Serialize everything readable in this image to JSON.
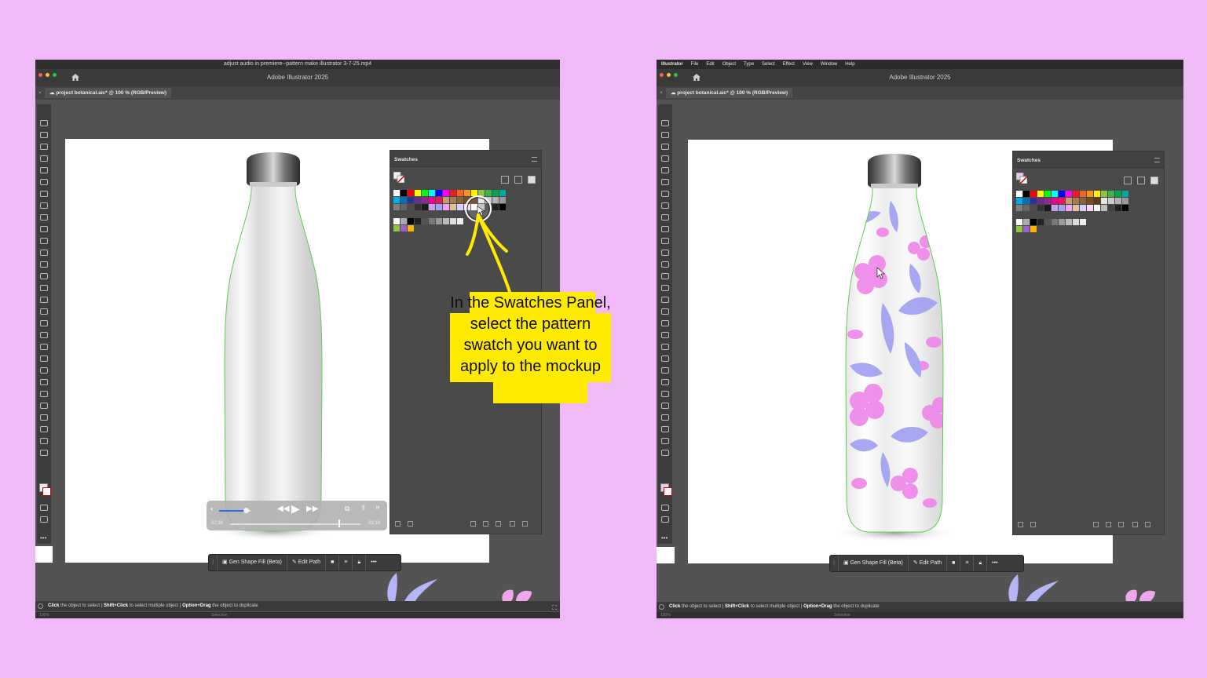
{
  "colors": {
    "background": "#f0b9f8",
    "callout_fill": "#ffeb00",
    "selection_outline": "#5ad04e",
    "pattern_pink": "#ee86e8",
    "pattern_lavender": "#9f9ef0"
  },
  "left_window": {
    "video_title": "adjust audio in premiere--pattern make illustrator 3-7-25.mp4",
    "app_title": "Adobe Illustrator 2025",
    "document_tab": "project botanical.aic* @ 100 % (RGB/Preview)",
    "swatches_title": "Swatches",
    "context_bar": {
      "gen_shape_fill": "Gen Shape Fill (Beta)",
      "edit_path": "Edit Path"
    },
    "status": {
      "part1_bold": "Click",
      "part1": " the object to select",
      "sep": "  |  ",
      "part2_bold": "Shift+Click",
      "part2": " to select multiple object",
      "part3_bold": "Option+Drag",
      "part3": " the object to duplicate"
    },
    "info": {
      "zoom": "100%",
      "mode": "Selection"
    },
    "player": {
      "elapsed": "02:38",
      "total": "03:10",
      "progress": 0.83,
      "volume": 0.85
    },
    "icons": [
      "home-icon",
      "volume-icon",
      "rewind-icon",
      "play-icon",
      "fast-forward-icon",
      "picture-in-picture-icon",
      "share-icon",
      "more-chevron-icon"
    ]
  },
  "right_window": {
    "menu": [
      "Illustrator",
      "File",
      "Edit",
      "Object",
      "Type",
      "Select",
      "Effect",
      "View",
      "Window",
      "Help"
    ],
    "app_title": "Adobe Illustrator 2025",
    "document_tab": "project botanical.aic* @ 100 % (RGB/Preview)",
    "swatches_title": "Swatches",
    "context_bar": {
      "gen_shape_fill": "Gen Shape Fill (Beta)",
      "edit_path": "Edit Path"
    },
    "status": {
      "part1_bold": "Click",
      "part1": " the object to select",
      "sep": "  |  ",
      "part2_bold": "Shift+Click",
      "part2": " to select multiple object",
      "part3_bold": "Option+Drag",
      "part3": " the object to duplicate"
    },
    "info": {
      "zoom": "100%",
      "mode": "Selection"
    }
  },
  "callout": {
    "text": "In the Swatches Panel, select the pattern swatch you want to apply to the mockup"
  }
}
